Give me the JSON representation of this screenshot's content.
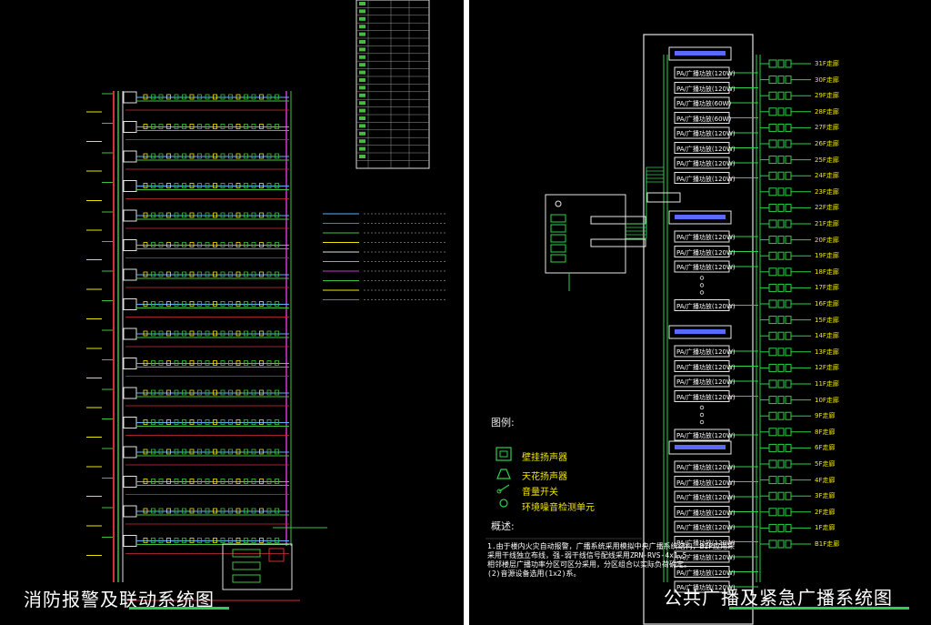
{
  "left": {
    "caption": "消防报警及联动系统图"
  },
  "right": {
    "caption": "公共广播及紧急广播系统图",
    "legend_title": "图例:",
    "legend": [
      {
        "icon": "wall-speaker-icon",
        "label": "壁挂扬声器"
      },
      {
        "icon": "ceiling-speaker-icon",
        "label": "天花扬声器"
      },
      {
        "icon": "volume-switch-icon",
        "label": "音量开关"
      },
      {
        "icon": "noise-sensor-icon",
        "label": "环境噪音检测单元"
      }
    ],
    "notes_title": "概述:",
    "notes_lines": [
      "1.由于楼内火灾自动报警，广播系统采用模拟中央广播系统结构，BIP应用采",
      "  采用干线独立布线，强-弱干线信号配线采用ZRN-RVS-4x1.5.",
      "  相邻楼层广播功率分区可区分采用，分区组合以实际负荷确定。",
      "  (2)音源设备选用(1x2)系。"
    ],
    "amp_labels": [
      "PA/广播功放(120W)",
      "PA/广播功放(60W)"
    ],
    "floors": [
      "31F走廊",
      "30F走廊",
      "29F走廊",
      "28F走廊",
      "27F走廊",
      "26F走廊",
      "25F走廊",
      "24F走廊",
      "23F走廊",
      "22F走廊",
      "21F走廊",
      "20F走廊",
      "19F走廊",
      "18F走廊",
      "17F走廊",
      "16F走廊",
      "15F走廊",
      "14F走廊",
      "13F走廊",
      "12F走廊",
      "11F走廊",
      "10F走廊",
      "9F走廊",
      "8F走廊",
      "6F走廊",
      "5F走廊",
      "4F走廊",
      "3F走廊",
      "2F走廊",
      "1F走廊",
      "B1F走廊"
    ]
  }
}
